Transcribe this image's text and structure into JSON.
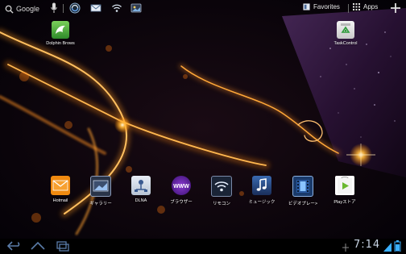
{
  "search": {
    "label": "Google"
  },
  "topbar": {
    "favorites_label": "Favorites",
    "apps_label": "Apps"
  },
  "shortcuts": [
    {
      "label": "Dolphin Brows",
      "icon": "dolphin-browser-icon"
    },
    {
      "label": "TaskControl",
      "icon": "task-control-icon"
    }
  ],
  "dock": [
    {
      "label": "Hotmail",
      "icon": "envelope-icon"
    },
    {
      "label": "ギャラリー",
      "icon": "gallery-icon"
    },
    {
      "label": "DLNA",
      "icon": "dlna-icon"
    },
    {
      "label": "ブラウザー",
      "icon": "browser-www-icon"
    },
    {
      "label": "リモコン",
      "icon": "wifi-remote-icon"
    },
    {
      "label": "ミュージック",
      "icon": "music-note-icon"
    },
    {
      "label": "ビデオプレー>",
      "icon": "film-icon"
    },
    {
      "label": "Playストア",
      "icon": "play-store-icon"
    }
  ],
  "statusbar": {
    "time": "7:14"
  },
  "colors": {
    "accent": "#e89a2a",
    "navbar": "#000000",
    "status_icons": "#3ab0ff"
  }
}
